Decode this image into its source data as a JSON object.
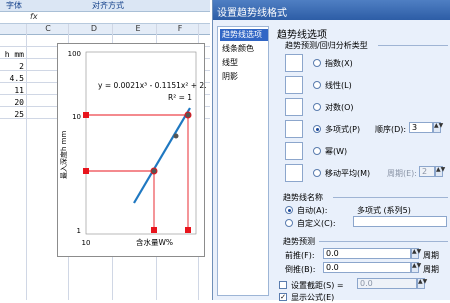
{
  "ribbon": {
    "font_group": "字体",
    "align_group": "对齐方式"
  },
  "formula_bar": {
    "fx": "fx"
  },
  "columns": [
    "C",
    "D",
    "E",
    "F"
  ],
  "sheet": {
    "col_a_values": [
      "h mm",
      "2",
      "4.5",
      "11",
      "20",
      "25"
    ]
  },
  "chart": {
    "equation": "y = 0.0021x³ - 0.1151x² + 2.53",
    "r2": "R² = 1",
    "y_axis_label": "最入深度h mm",
    "x_axis_label": "含水量W%",
    "y_ticks": [
      "100",
      "10",
      "1"
    ],
    "x_ticks": [
      "10"
    ],
    "colors": {
      "line": "#1f78c1",
      "guide": "#e8141c",
      "point": "#555555"
    }
  },
  "dialog": {
    "title": "设置趋势线格式",
    "nav": [
      "趋势线选项",
      "线条颜色",
      "线型",
      "阴影"
    ],
    "heading": "趋势线选项",
    "type_group": "趋势预测/回归分析类型",
    "types": [
      {
        "label": "指数(X)",
        "checked": false
      },
      {
        "label": "线性(L)",
        "checked": false
      },
      {
        "label": "对数(O)",
        "checked": false
      },
      {
        "label": "多项式(P)",
        "checked": true
      },
      {
        "label": "幂(W)",
        "checked": false
      },
      {
        "label": "移动平均(M)",
        "checked": false
      }
    ],
    "order_label": "顺序(D):",
    "order_value": "3",
    "period_label": "周期(E):",
    "period_value": "2",
    "name_group": "趋势线名称",
    "auto_label": "自动(A):",
    "auto_value": "多项式 (系列5)",
    "custom_label": "自定义(C):",
    "forecast_group": "趋势预测",
    "forward_label": "前推(F):",
    "forward_value": "0.0",
    "backward_label": "倒推(B):",
    "backward_value": "0.0",
    "unit": "周期",
    "intercept_label": "设置截距(S) =",
    "intercept_value": "0.0",
    "show_equation_label": "显示公式(E)"
  }
}
